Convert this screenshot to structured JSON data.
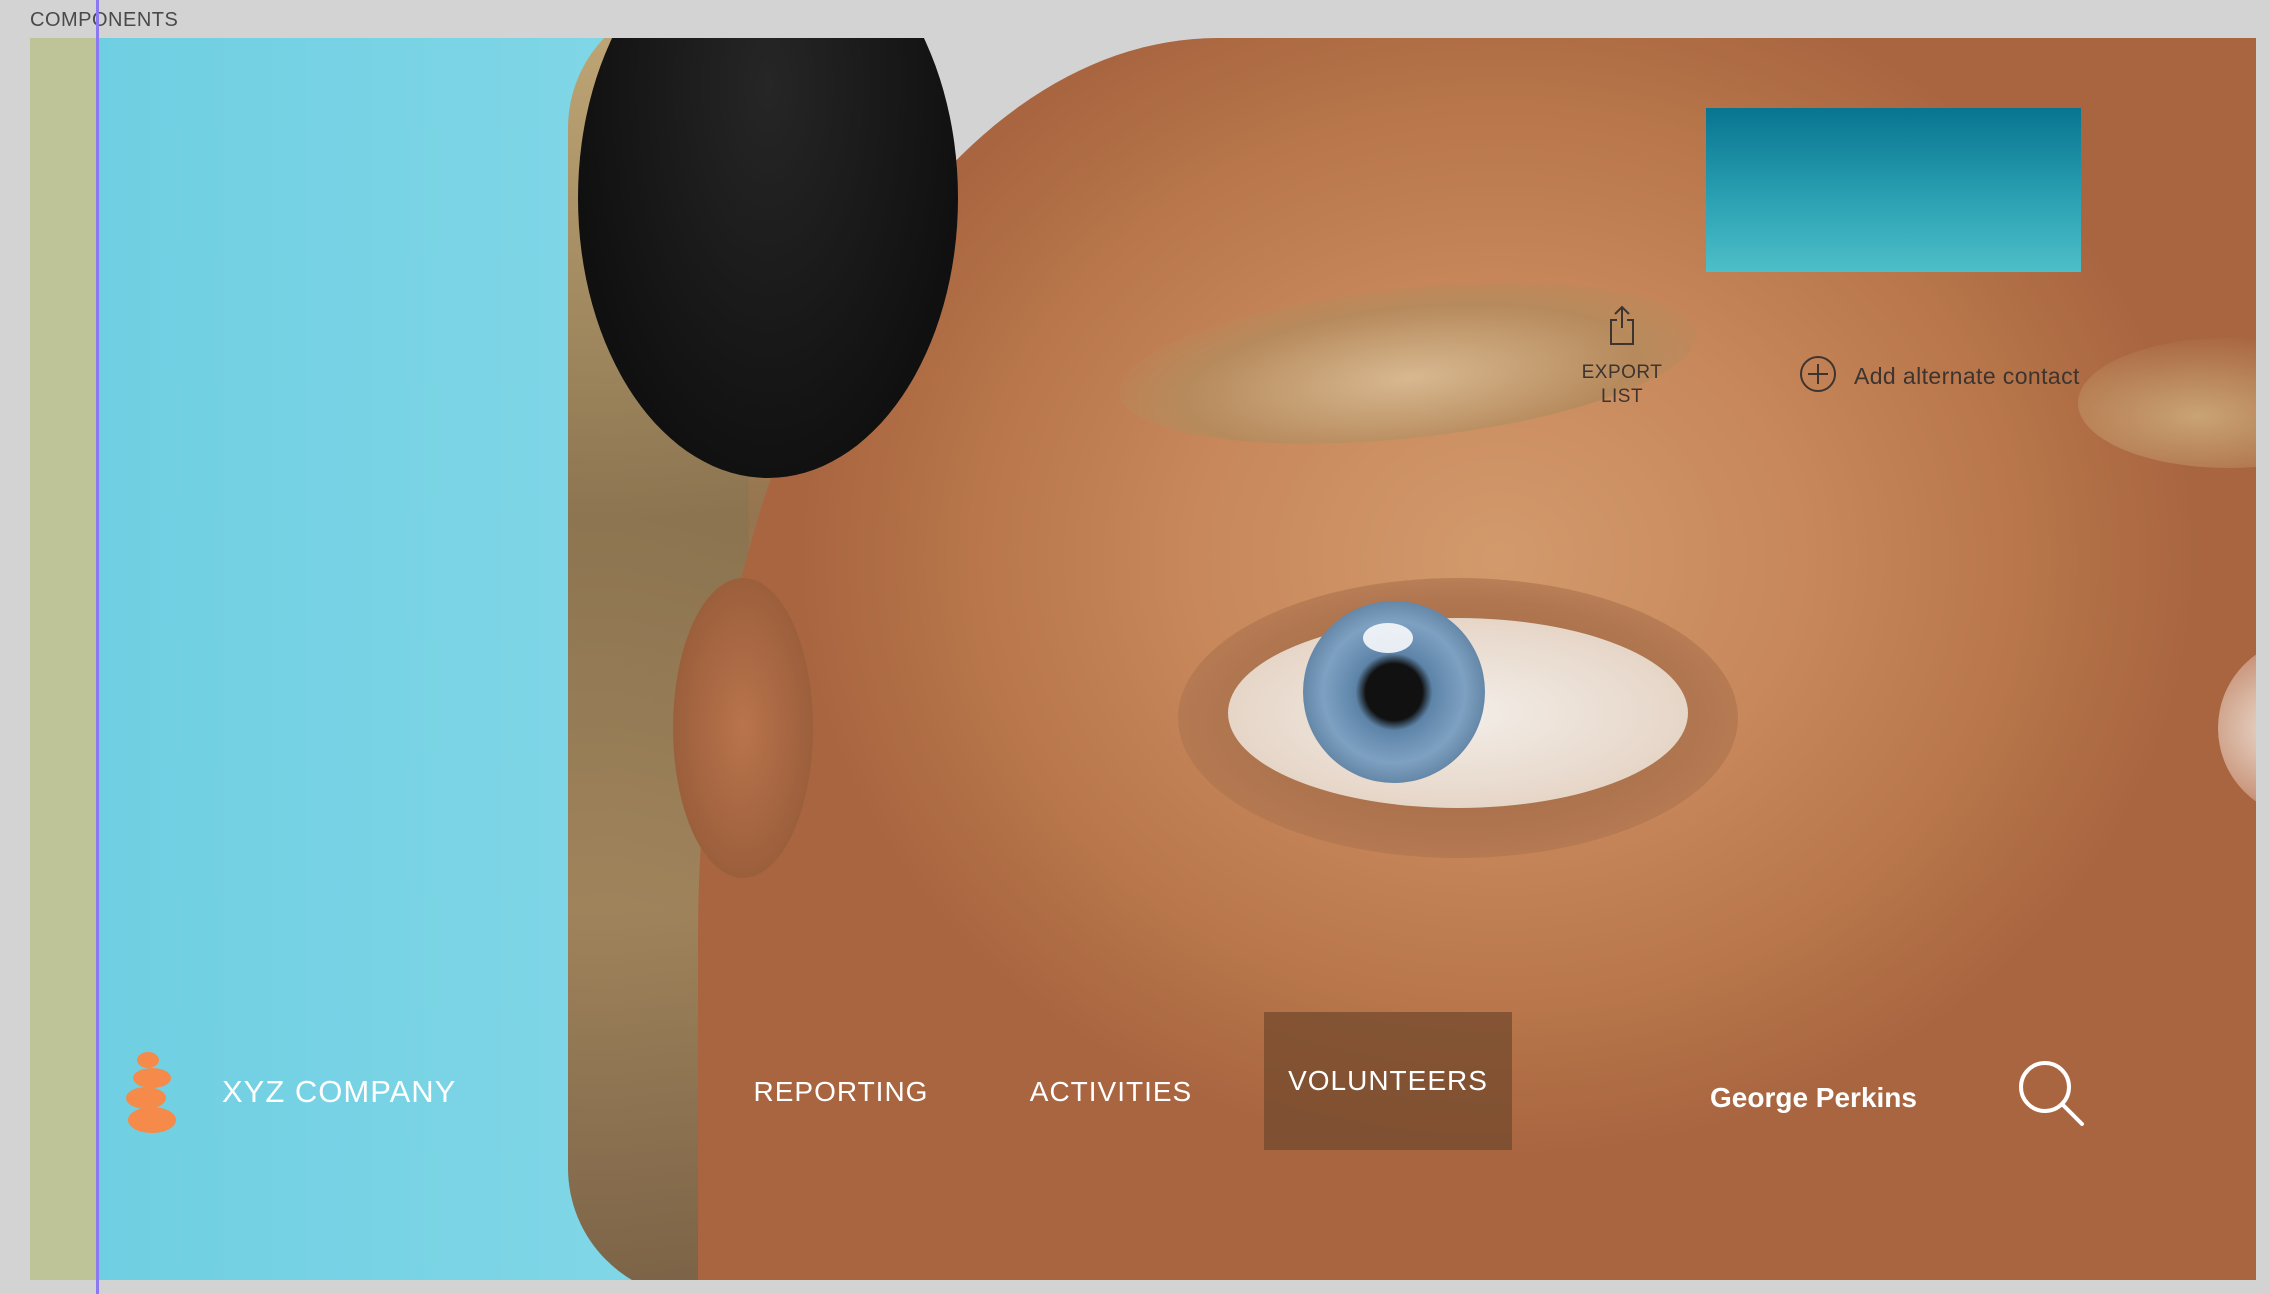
{
  "canvas": {
    "label": "COMPONENTS"
  },
  "toolbar": {
    "export_label": "EXPORT LIST",
    "add_contact_label": "Add alternate contact"
  },
  "navbar": {
    "company": "XYZ COMPANY",
    "items": [
      {
        "label": "REPORTING",
        "active": false
      },
      {
        "label": "ACTIVITIES",
        "active": false
      },
      {
        "label": "VOLUNTEERS",
        "active": true
      }
    ],
    "user_name": "George Perkins",
    "icons": [
      "logo-stones-icon",
      "search-icon",
      "export-icon",
      "add-circle-icon"
    ]
  },
  "colors": {
    "strip": "#bec497",
    "guide": "#8c78f0",
    "teal_card_top": "#087490",
    "teal_card_bottom": "#4dbfc8",
    "logo": "#f58a4b",
    "active_nav_bg": "#70482c"
  }
}
